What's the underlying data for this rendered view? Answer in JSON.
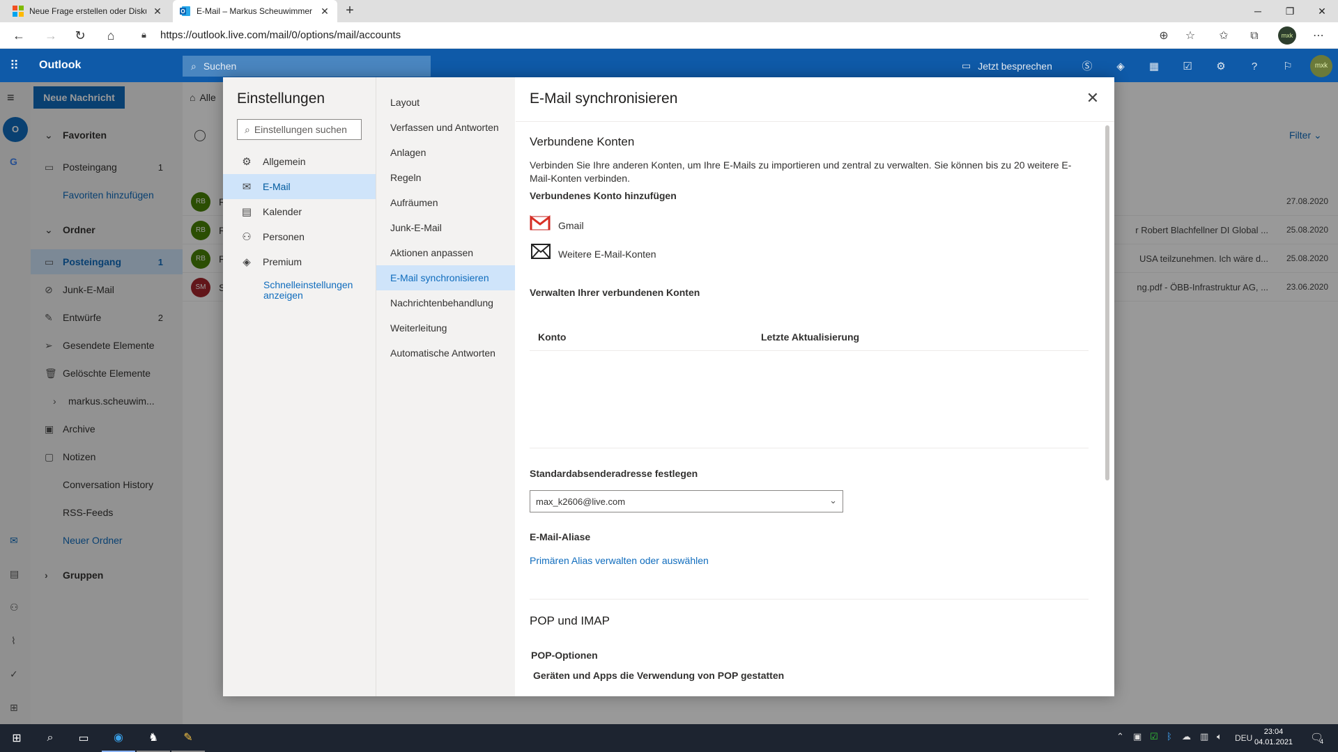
{
  "browser": {
    "tabs": [
      {
        "title": "Neue Frage erstellen oder Disku"
      },
      {
        "title": "E-Mail – Markus Scheuwimmer –"
      }
    ],
    "url": "https://outlook.live.com/mail/0/options/mail/accounts",
    "profile_initials": "mxk"
  },
  "outlook": {
    "brand": "Outlook",
    "search_placeholder": "Suchen",
    "meet_label": "Jetzt besprechen",
    "new_message": "Neue Nachricht",
    "filter_label": "Filter",
    "folders": [
      {
        "label": "Favoriten",
        "count": "",
        "icon": "chevron-down"
      },
      {
        "label": "Posteingang",
        "count": "1",
        "icon": "inbox"
      },
      {
        "label": "Favoriten hinzufügen",
        "count": "",
        "icon": ""
      },
      {
        "label": "Ordner",
        "count": "",
        "icon": "chevron-down"
      },
      {
        "label": "Posteingang",
        "count": "1",
        "icon": "inbox"
      },
      {
        "label": "Junk-E-Mail",
        "count": "",
        "icon": "block"
      },
      {
        "label": "Entwürfe",
        "count": "2",
        "icon": "pencil"
      },
      {
        "label": "Gesendete Elemente",
        "count": "",
        "icon": "send"
      },
      {
        "label": "Gelöschte Elemente",
        "count": "",
        "icon": "trash"
      },
      {
        "label": "markus.scheuwim...",
        "count": "",
        "icon": "chevron-right"
      },
      {
        "label": "Archive",
        "count": "",
        "icon": "archive"
      },
      {
        "label": "Notizen",
        "count": "",
        "icon": "note"
      },
      {
        "label": "Conversation History",
        "count": "",
        "icon": ""
      },
      {
        "label": "RSS-Feeds",
        "count": "",
        "icon": ""
      },
      {
        "label": "Neuer Ordner",
        "count": "",
        "icon": ""
      },
      {
        "label": "Gruppen",
        "count": "",
        "icon": "chevron-right"
      }
    ],
    "list_header_partial": "Alle",
    "messages": [
      {
        "initials": "RB",
        "color": "#498205",
        "sender": "R",
        "preview": "",
        "date": "27.08.2020"
      },
      {
        "initials": "RB",
        "color": "#498205",
        "sender": "R",
        "preview": "r Robert Blachfellner DI Global ...",
        "date": "25.08.2020"
      },
      {
        "initials": "RB",
        "color": "#498205",
        "sender": "R",
        "preview": "USA teilzunehmen. Ich wäre d...",
        "date": "25.08.2020"
      },
      {
        "initials": "SM",
        "color": "#a4262c",
        "sender": "S",
        "preview": "ng.pdf - ÖBB-Infrastruktur AG, ...",
        "date": "23.06.2020"
      }
    ]
  },
  "settings": {
    "title": "Einstellungen",
    "search_placeholder": "Einstellungen suchen",
    "categories": [
      {
        "label": "Allgemein",
        "icon": "gear-icon"
      },
      {
        "label": "E-Mail",
        "icon": "mail-icon"
      },
      {
        "label": "Kalender",
        "icon": "calendar-icon"
      },
      {
        "label": "Personen",
        "icon": "people-icon"
      },
      {
        "label": "Premium",
        "icon": "diamond-icon"
      }
    ],
    "quick_settings": "Schnelleinstellungen anzeigen",
    "subcategories": [
      "Layout",
      "Verfassen und Antworten",
      "Anlagen",
      "Regeln",
      "Aufräumen",
      "Junk-E-Mail",
      "Aktionen anpassen",
      "E-Mail synchronisieren",
      "Nachrichtenbehandlung",
      "Weiterleitung",
      "Automatische Antworten"
    ],
    "selected_subcategory_index": 7,
    "pane": {
      "title": "E-Mail synchronisieren",
      "connected_heading": "Verbundene Konten",
      "connected_desc": "Verbinden Sie Ihre anderen Konten, um Ihre E-Mails zu importieren und zentral zu verwalten. Sie können bis zu 20 weitere E-Mail-Konten verbinden.",
      "add_heading": "Verbundenes Konto hinzufügen",
      "gmail": "Gmail",
      "other": "Weitere E-Mail-Konten",
      "manage_heading": "Verwalten Ihrer verbundenen Konten",
      "col_account": "Konto",
      "col_updated": "Letzte Aktualisierung",
      "default_sender_heading": "Standardabsenderadresse festlegen",
      "default_sender_value": "max_k2606@live.com",
      "alias_heading": "E-Mail-Aliase",
      "alias_link": "Primären Alias verwalten oder auswählen",
      "pop_heading": "POP und IMAP",
      "pop_options": "POP-Optionen",
      "pop_desc": "Geräten und Apps die Verwendung von POP gestatten"
    }
  },
  "taskbar": {
    "language": "DEU",
    "time": "23:04",
    "date": "04.01.2021",
    "notifications": "4"
  }
}
